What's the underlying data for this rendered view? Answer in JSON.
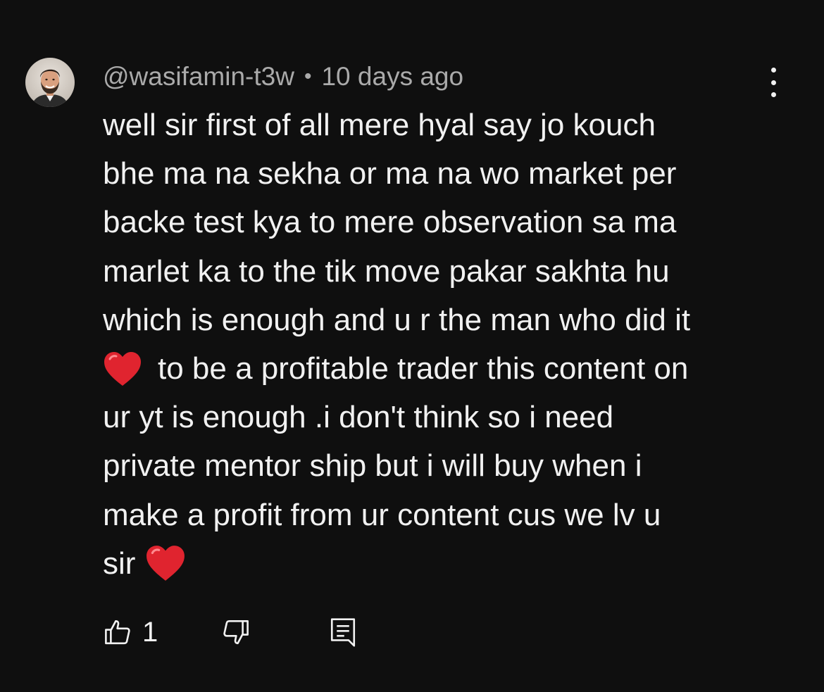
{
  "comment": {
    "author_handle": "@wasifamin-t3w",
    "separator": "•",
    "timestamp": "10 days ago",
    "lines": [
      "well sir first of all mere hyal say jo kouch",
      "bhe ma na sekha or ma na wo market per",
      "backe test kya to mere observation sa ma",
      "marlet ka to the tik move pakar sakhta hu",
      "which is enough and u r the man who did it",
      "to be a profitable trader this content on",
      "ur yt is enough .i don't think so i need",
      "private mentor ship but i will buy when i",
      "make a profit from ur content cus we lv u",
      "sir"
    ],
    "emoji": "heart-emoji",
    "like_count": "1"
  },
  "icons": {
    "menu": "more-vert-icon",
    "like": "thumbs-up-icon",
    "dislike": "thumbs-down-icon",
    "reply": "reply-comment-icon"
  },
  "colors": {
    "background": "#0f0f0f",
    "text": "#f1f1f1",
    "meta_text": "#aaaaaa",
    "heart": "#e0242f"
  }
}
